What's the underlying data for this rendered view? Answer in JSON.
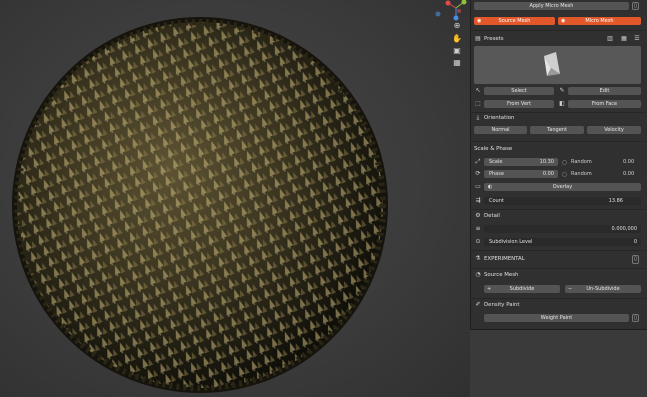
{
  "top": {
    "apply_label": "Apply Micro Mesh",
    "source_mesh": "Source Mesh",
    "micro_mesh": "Micro Mesh"
  },
  "presets": {
    "header": "Presets",
    "select": "Select",
    "edit": "Edit",
    "from_vert": "From Vert",
    "from_face": "From Face"
  },
  "orientation": {
    "header": "Orientation",
    "options": [
      "Normal",
      "Tangent",
      "Velocity"
    ]
  },
  "scale_phase": {
    "header": "Scale & Phase",
    "scale_label": "Scale",
    "scale_value": "10.30",
    "random_label": "Random",
    "random_value": "0.00",
    "phase_label": "Phase",
    "phase_value": "0.00",
    "random2_label": "Random",
    "random2_value": "0.00",
    "overlay": "Overlay",
    "count_label": "Count",
    "count_value": "13.86"
  },
  "detail": {
    "header": "Detail",
    "detail_value": "0.000,000",
    "subdivision_label": "Subdivision Level",
    "subdivision_value": "0"
  },
  "experimental": {
    "header": "EXPERIMENTAL"
  },
  "source_mesh_section": {
    "header": "Source Mesh",
    "subdivide": "Subdivide",
    "unsubdivide": "Un-Subdivide"
  },
  "density": {
    "header": "Density Paint",
    "weight_paint": "Weight Paint"
  },
  "colors": {
    "accent": "#e2582a",
    "panel_bg": "#303030",
    "button": "#545454",
    "viewport": "#3e3e3e"
  },
  "icons": [
    "gizmo-axes",
    "zoom-icon",
    "hand-icon",
    "camera-icon",
    "grid-icon",
    "eye-icon",
    "trash-icon"
  ]
}
